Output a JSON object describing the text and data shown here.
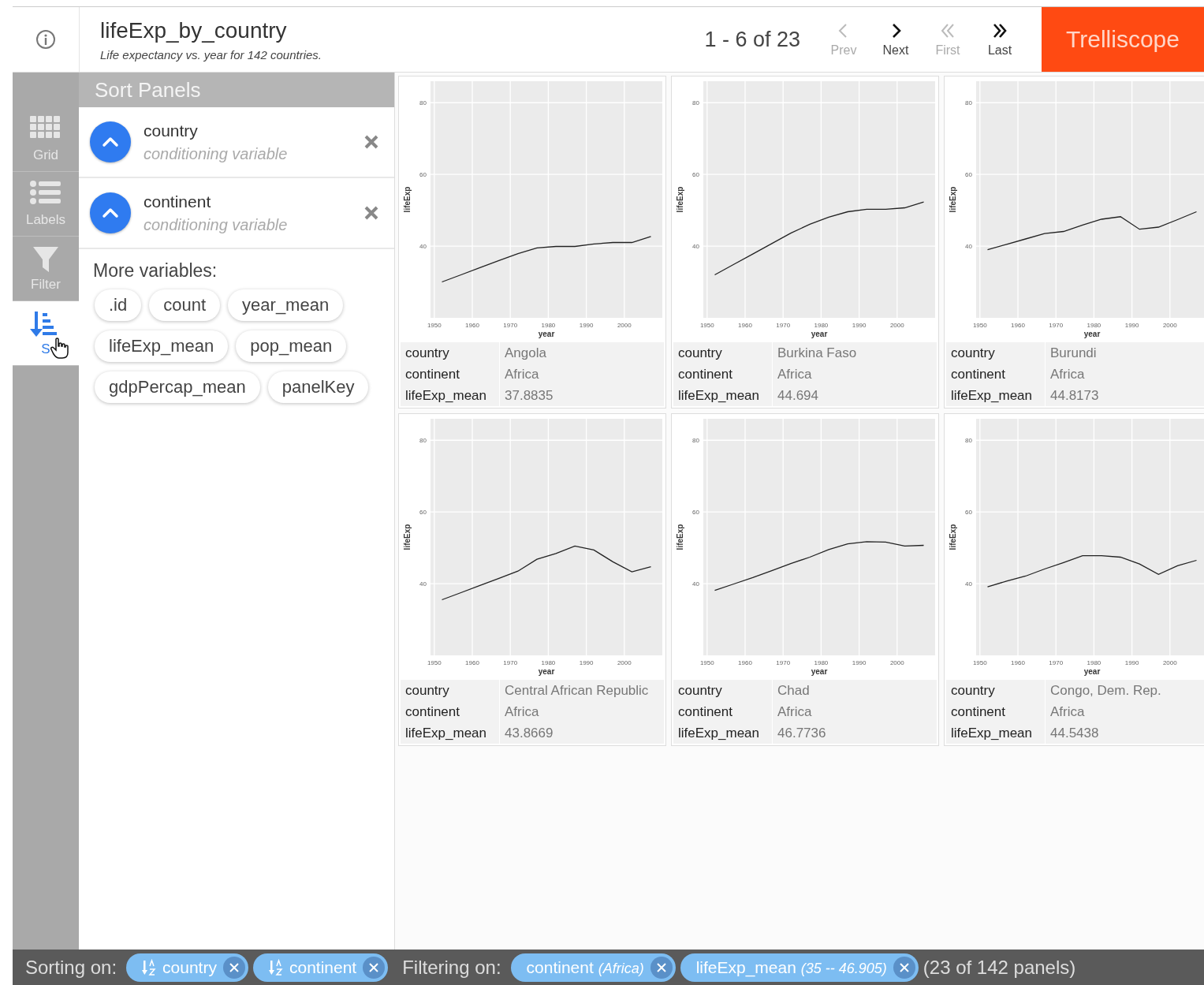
{
  "header": {
    "title": "lifeExp_by_country",
    "subtitle": "Life expectancy vs. year for 142 countries.",
    "pager": "1 - 6 of 23",
    "nav": [
      {
        "kind": "prev",
        "label": "Prev",
        "disabled": true
      },
      {
        "kind": "next",
        "label": "Next",
        "disabled": false
      },
      {
        "kind": "first",
        "label": "First",
        "disabled": true
      },
      {
        "kind": "last",
        "label": "Last",
        "disabled": false
      }
    ],
    "brand": "Trelliscope"
  },
  "sidebar": {
    "items": [
      {
        "kind": "grid",
        "label": "Grid",
        "selected": false
      },
      {
        "kind": "labels",
        "label": "Labels",
        "selected": false
      },
      {
        "kind": "filter",
        "label": "Filter",
        "selected": false
      },
      {
        "kind": "sort",
        "label": "S",
        "selected": true
      }
    ]
  },
  "sort_panel": {
    "title": "Sort Panels",
    "sorts": [
      {
        "name": "country",
        "description": "conditioning variable"
      },
      {
        "name": "continent",
        "description": "conditioning variable"
      }
    ],
    "more_label": "More variables:",
    "variables": [
      ".id",
      "count",
      "year_mean",
      "lifeExp_mean",
      "pop_mean",
      "gdpPercap_mean",
      "panelKey"
    ]
  },
  "panels": [
    {
      "chart_data": {
        "type": "line",
        "xlabel": "year",
        "ylabel": "lifeExp",
        "x": [
          1952,
          1957,
          1962,
          1967,
          1972,
          1977,
          1982,
          1987,
          1992,
          1997,
          2002,
          2007
        ],
        "values": [
          30.0,
          32.0,
          34.0,
          36.0,
          37.9,
          39.5,
          39.9,
          39.9,
          40.6,
          41.0,
          41.0,
          42.7
        ],
        "grid": true,
        "xlim": [
          1949,
          2010
        ],
        "ylim": [
          20,
          86
        ],
        "xticks": [
          1950,
          1960,
          1970,
          1980,
          1990,
          2000
        ],
        "yticks": [
          40,
          60,
          80
        ]
      },
      "labels": [
        {
          "name": "country",
          "value": "Angola"
        },
        {
          "name": "continent",
          "value": "Africa"
        },
        {
          "name": "lifeExp_mean",
          "value": "37.8835"
        }
      ]
    },
    {
      "chart_data": {
        "type": "line",
        "xlabel": "year",
        "ylabel": "lifeExp",
        "x": [
          1952,
          1957,
          1962,
          1967,
          1972,
          1977,
          1982,
          1987,
          1992,
          1997,
          2002,
          2007
        ],
        "values": [
          32.0,
          34.9,
          37.8,
          40.7,
          43.6,
          46.1,
          48.1,
          49.6,
          50.3,
          50.3,
          50.7,
          52.3
        ],
        "grid": true,
        "xlim": [
          1949,
          2010
        ],
        "ylim": [
          20,
          86
        ],
        "xticks": [
          1950,
          1960,
          1970,
          1980,
          1990,
          2000
        ],
        "yticks": [
          40,
          60,
          80
        ]
      },
      "labels": [
        {
          "name": "country",
          "value": "Burkina Faso"
        },
        {
          "name": "continent",
          "value": "Africa"
        },
        {
          "name": "lifeExp_mean",
          "value": "44.694"
        }
      ]
    },
    {
      "chart_data": {
        "type": "line",
        "xlabel": "year",
        "ylabel": "lifeExp",
        "x": [
          1952,
          1957,
          1962,
          1967,
          1972,
          1977,
          1982,
          1987,
          1992,
          1997,
          2002,
          2007
        ],
        "values": [
          39.0,
          40.5,
          42.0,
          43.5,
          44.1,
          45.9,
          47.5,
          48.2,
          44.7,
          45.3,
          47.4,
          49.6
        ],
        "grid": true,
        "xlim": [
          1949,
          2010
        ],
        "ylim": [
          20,
          86
        ],
        "xticks": [
          1950,
          1960,
          1970,
          1980,
          1990,
          2000
        ],
        "yticks": [
          40,
          60,
          80
        ]
      },
      "labels": [
        {
          "name": "country",
          "value": "Burundi"
        },
        {
          "name": "continent",
          "value": "Africa"
        },
        {
          "name": "lifeExp_mean",
          "value": "44.8173"
        }
      ]
    },
    {
      "chart_data": {
        "type": "line",
        "xlabel": "year",
        "ylabel": "lifeExp",
        "x": [
          1952,
          1957,
          1962,
          1967,
          1972,
          1977,
          1982,
          1987,
          1992,
          1997,
          2002,
          2007
        ],
        "values": [
          35.5,
          37.5,
          39.5,
          41.5,
          43.5,
          46.8,
          48.4,
          50.5,
          49.4,
          46.1,
          43.3,
          44.7
        ],
        "grid": true,
        "xlim": [
          1949,
          2010
        ],
        "ylim": [
          20,
          86
        ],
        "xticks": [
          1950,
          1960,
          1970,
          1980,
          1990,
          2000
        ],
        "yticks": [
          40,
          60,
          80
        ]
      },
      "labels": [
        {
          "name": "country",
          "value": "Central African Republic"
        },
        {
          "name": "continent",
          "value": "Africa"
        },
        {
          "name": "lifeExp_mean",
          "value": "43.8669"
        }
      ]
    },
    {
      "chart_data": {
        "type": "line",
        "xlabel": "year",
        "ylabel": "lifeExp",
        "x": [
          1952,
          1957,
          1962,
          1967,
          1972,
          1977,
          1982,
          1987,
          1992,
          1997,
          2002,
          2007
        ],
        "values": [
          38.1,
          39.9,
          41.7,
          43.6,
          45.6,
          47.4,
          49.5,
          51.1,
          51.7,
          51.6,
          50.5,
          50.7
        ],
        "grid": true,
        "xlim": [
          1949,
          2010
        ],
        "ylim": [
          20,
          86
        ],
        "xticks": [
          1950,
          1960,
          1970,
          1980,
          1990,
          2000
        ],
        "yticks": [
          40,
          60,
          80
        ]
      },
      "labels": [
        {
          "name": "country",
          "value": "Chad"
        },
        {
          "name": "continent",
          "value": "Africa"
        },
        {
          "name": "lifeExp_mean",
          "value": "46.7736"
        }
      ]
    },
    {
      "chart_data": {
        "type": "line",
        "xlabel": "year",
        "ylabel": "lifeExp",
        "x": [
          1952,
          1957,
          1962,
          1967,
          1972,
          1977,
          1982,
          1987,
          1992,
          1997,
          2002,
          2007
        ],
        "values": [
          39.1,
          40.7,
          42.1,
          44.1,
          45.9,
          47.8,
          47.8,
          47.4,
          45.5,
          42.6,
          45.0,
          46.5
        ],
        "grid": true,
        "xlim": [
          1949,
          2010
        ],
        "ylim": [
          20,
          86
        ],
        "xticks": [
          1950,
          1960,
          1970,
          1980,
          1990,
          2000
        ],
        "yticks": [
          40,
          60,
          80
        ]
      },
      "labels": [
        {
          "name": "country",
          "value": "Congo, Dem. Rep."
        },
        {
          "name": "continent",
          "value": "Africa"
        },
        {
          "name": "lifeExp_mean",
          "value": "44.5438"
        }
      ]
    }
  ],
  "status_bar": {
    "sorting_label": "Sorting on:",
    "sorts": [
      {
        "name": "country"
      },
      {
        "name": "continent"
      }
    ],
    "filtering_label": "Filtering on:",
    "filters": [
      {
        "name": "continent",
        "range": "(Africa)"
      },
      {
        "name": "lifeExp_mean",
        "range": "(35 -- 46.905)"
      }
    ],
    "count": "(23 of 142 panels)"
  }
}
